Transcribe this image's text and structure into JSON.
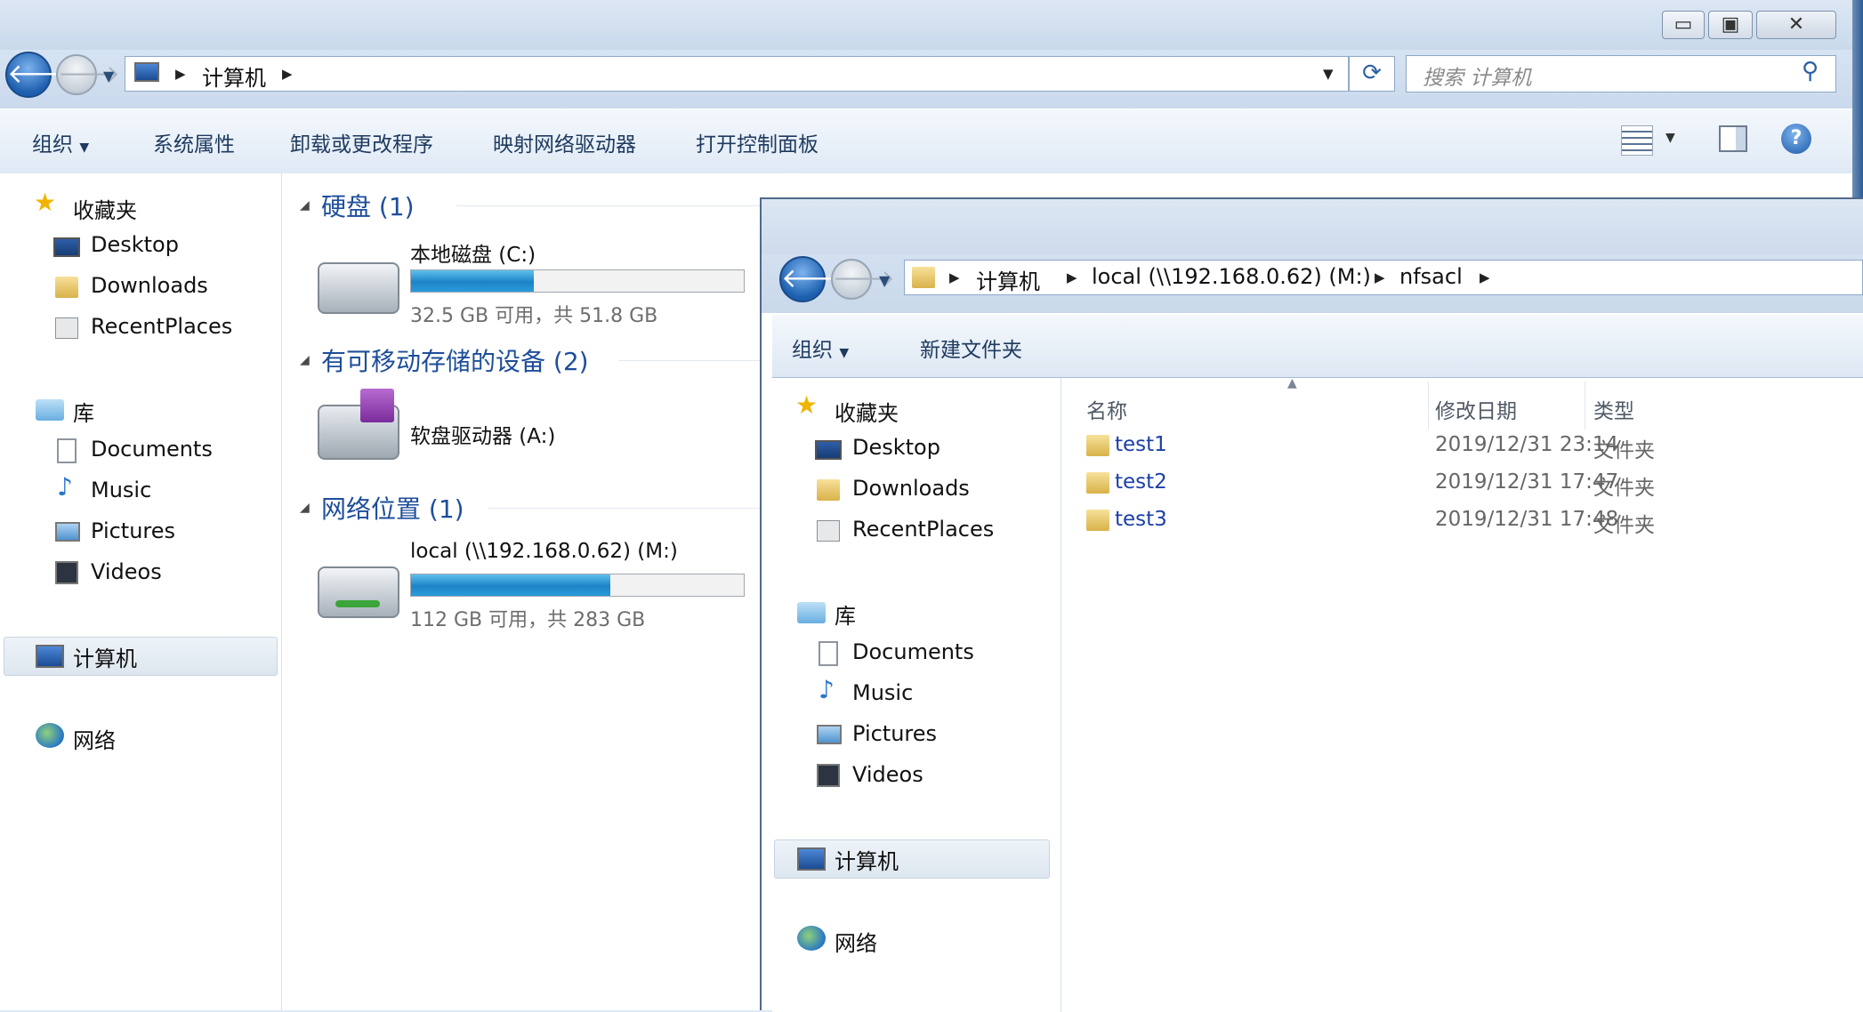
{
  "window1": {
    "address": {
      "crumbs": [
        "计算机"
      ]
    },
    "search": {
      "placeholder": "搜索 计算机"
    },
    "toolbar": {
      "organize": "组织",
      "system_properties": "系统属性",
      "uninstall": "卸载或更改程序",
      "map_drive": "映射网络驱动器",
      "control_panel": "打开控制面板"
    },
    "nav": {
      "favorites": "收藏夹",
      "favorites_items": [
        "Desktop",
        "Downloads",
        "RecentPlaces"
      ],
      "libraries": "库",
      "library_items": [
        "Documents",
        "Music",
        "Pictures",
        "Videos"
      ],
      "computer": "计算机",
      "network": "网络"
    },
    "groups": {
      "hard_disks": {
        "label": "硬盘 (1)",
        "item_name": "本地磁盘 (C:)",
        "item_sub": "32.5 GB 可用，共 51.8 GB",
        "used_fraction": 0.37
      },
      "removable": {
        "label": "有可移动存储的设备 (2)",
        "item_name": "软盘驱动器 (A:)"
      },
      "network_locations": {
        "label": "网络位置 (1)",
        "item_name": "local (\\\\192.168.0.62) (M:)",
        "item_sub": "112 GB 可用，共 283 GB",
        "used_fraction": 0.6
      }
    }
  },
  "window2": {
    "address": {
      "crumbs": [
        "计算机",
        "local (\\\\192.168.0.62) (M:)",
        "nfsacl"
      ]
    },
    "toolbar": {
      "organize": "组织",
      "new_folder": "新建文件夹"
    },
    "nav": {
      "favorites": "收藏夹",
      "favorites_items": [
        "Desktop",
        "Downloads",
        "RecentPlaces"
      ],
      "libraries": "库",
      "library_items": [
        "Documents",
        "Music",
        "Pictures",
        "Videos"
      ],
      "computer": "计算机",
      "network": "网络"
    },
    "columns": {
      "name": "名称",
      "modified": "修改日期",
      "type": "类型"
    },
    "files": [
      {
        "name": "test1",
        "modified": "2019/12/31 23:14",
        "type": "文件夹"
      },
      {
        "name": "test2",
        "modified": "2019/12/31 17:47",
        "type": "文件夹"
      },
      {
        "name": "test3",
        "modified": "2019/12/31 17:48",
        "type": "文件夹"
      }
    ]
  }
}
